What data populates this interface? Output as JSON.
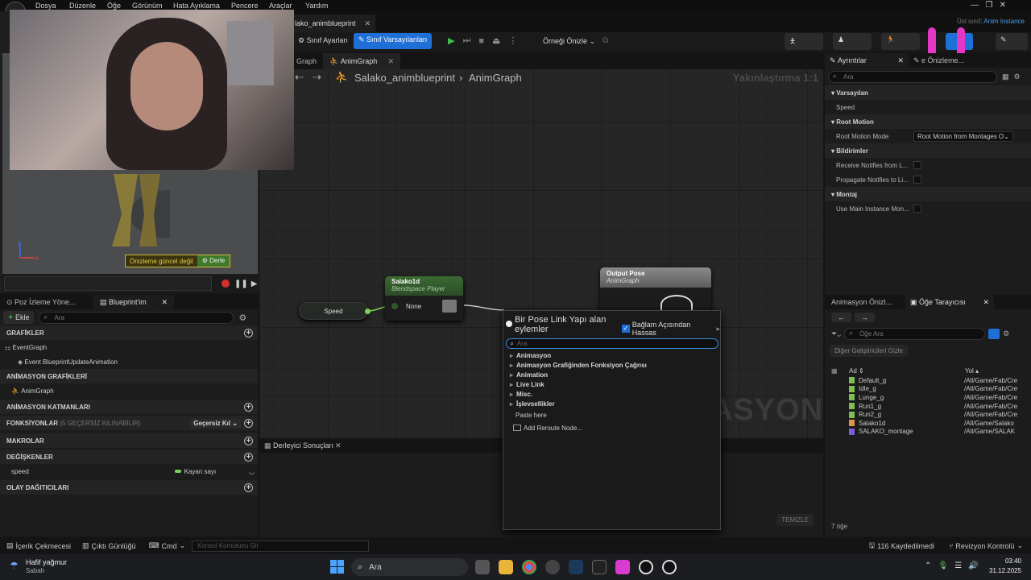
{
  "menu": [
    "Dosya",
    "Düzenle",
    "Öğe",
    "Görünüm",
    "Hata Ayıklama",
    "Pencere",
    "Araçlar",
    "Yardım"
  ],
  "doc_tab": "lako_animblueprint",
  "parent_class": {
    "label": "Üst sınıf:",
    "value": "Anim Instance"
  },
  "toolbar": {
    "class_settings": "Sınıf Ayarları",
    "class_defaults": "Sınıf Varsayılanları",
    "preview_instance": "Örneği Önizle"
  },
  "graph_tabs": [
    "Graph",
    "AnimGraph"
  ],
  "breadcrumb": {
    "root": "Salako_animblueprint",
    "current": "AnimGraph"
  },
  "zoom": "Yakınlaştırma 1:1",
  "watermark": "ASYON",
  "nodes": {
    "speed": "Speed",
    "blendspace_title": "Salako1d",
    "blendspace_sub": "Blendspace Player",
    "pin_none": "None",
    "output_title": "Output Pose",
    "output_sub": "AnimGraph"
  },
  "context_menu": {
    "title": "Bir Pose Link Yapı alan eylemler",
    "context_sensitive": "Bağlam Açısından Hassas",
    "search_placeholder": "Ara",
    "categories": [
      "Animasyon",
      "Animasyon Grafiğinden Fonksiyon Çağrısı",
      "Animation",
      "Live Link",
      "Misc.",
      "İşlevsellikler"
    ],
    "actions": [
      "Paste here",
      "Add Reroute Node..."
    ]
  },
  "compiler": {
    "tab": "Derleyici Sonuçları",
    "clear": "TEMİZLE"
  },
  "viewport": {
    "warning": "Önizleme güncel değil",
    "compile": "Derle"
  },
  "left_tabs": [
    "Poz İzleme Yöne...",
    "Blueprint'im"
  ],
  "myblueprint": {
    "add": "Ekle",
    "search": "Ara",
    "graphs_header": "GRAFİKLER",
    "event_graph": "EventGraph",
    "event_node": "Event BlueprintUpdateAnimation",
    "anim_graphs_header": "ANİMASYON GRAFİKLERİ",
    "anim_graph": "AnimGraph",
    "anim_layers_header": "ANİMASYON KATMANLARI",
    "functions_header": "FONKSİYONLAR",
    "functions_note": "(5 GEÇERSİZ KILINABİLİR)",
    "override": "Geçersiz Kıl",
    "macros_header": "MAKROLAR",
    "variables_header": "DEĞİŞKENLER",
    "var_name": "speed",
    "var_type": "Kayan sayı",
    "dispatchers_header": "OLAY DAĞITICILARI"
  },
  "details": {
    "tab": "Ayrıntılar",
    "tab2": "e Önizleme...",
    "search": "Ara",
    "sec_defaults": "Varsayılan",
    "speed": "Speed",
    "sec_root": "Root Motion",
    "root_mode_label": "Root Motion Mode",
    "root_mode_value": "Root Motion from Montages Or",
    "sec_notify": "Bildirimler",
    "notify1": "Receive Notifies from L...",
    "notify2": "Propagate Notifies to Li...",
    "sec_montage": "Montaj",
    "montage1": "Use Main Instance Mon..."
  },
  "browser": {
    "tab1": "Animasyon Önizl...",
    "tab2": "Öğe Tarayıcısı",
    "search": "Öğe Ara",
    "hide_others": "Diğer Geliştiricileri Gizle",
    "col_name": "Ad",
    "col_path": "Yol",
    "assets": [
      {
        "name": "Default_g",
        "path": "/All/Game/Fab/Cre",
        "color": "#7fbf4f"
      },
      {
        "name": "Idle_g",
        "path": "/All/Game/Fab/Cre",
        "color": "#7fbf4f"
      },
      {
        "name": "Lunge_g",
        "path": "/All/Game/Fab/Cre",
        "color": "#7fbf4f"
      },
      {
        "name": "Run1_g",
        "path": "/All/Game/Fab/Cre",
        "color": "#7fbf4f"
      },
      {
        "name": "Run2_g",
        "path": "/All/Game/Fab/Cre",
        "color": "#7fbf4f"
      },
      {
        "name": "Salako1d",
        "path": "/All/Game/Salako",
        "color": "#e0944a"
      },
      {
        "name": "SALAKO_montage",
        "path": "/All/Game/SALAK",
        "color": "#7a5cd6"
      }
    ],
    "count": "7 öğe"
  },
  "statusbar": {
    "content": "İçerik Çekmecesi",
    "output": "Çıktı Günlüğü",
    "cmd": "Cmd",
    "console": "Konsol Komutunu Gir",
    "saved": "116 Kaydedilmedi",
    "revision": "Revizyon Kontrolü"
  },
  "taskbar": {
    "weather": "Hafif yağmur",
    "weather_sub": "Sabah",
    "search": "Ara",
    "time": "03:40",
    "date": "31.12.2025"
  },
  "colors": {
    "accent": "#1e6fd6",
    "node_green": "#3b6b32",
    "output_grey": "#8a8a8a",
    "magenta": "#e437c8"
  }
}
